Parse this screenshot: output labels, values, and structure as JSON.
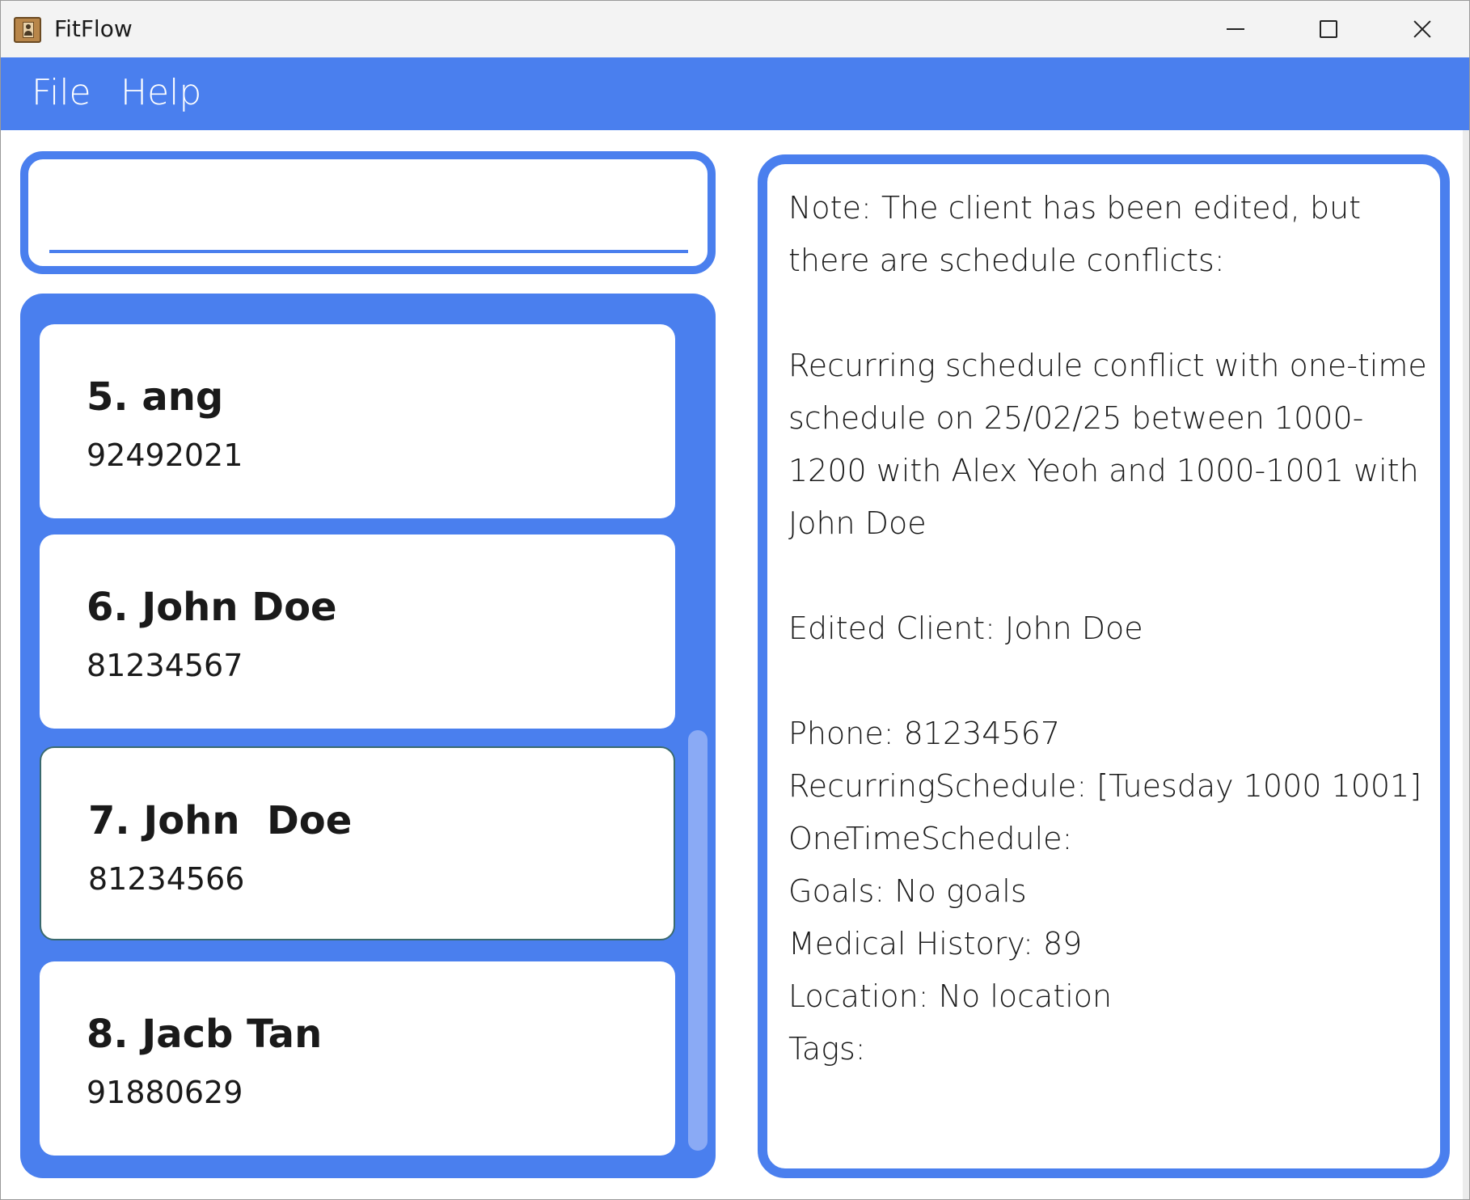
{
  "window": {
    "title": "FitFlow",
    "app_icon": "address-book-icon"
  },
  "menu": {
    "file_label": "File",
    "help_label": "Help"
  },
  "command_box": {
    "value": "",
    "placeholder": ""
  },
  "clients": [
    {
      "name": "5. ang",
      "phone": "92492021",
      "selected": false
    },
    {
      "name": "6. John Doe",
      "phone": "81234567",
      "selected": false
    },
    {
      "name": "7. John  Doe",
      "phone": "81234566",
      "selected": true
    },
    {
      "name": "8. Jacb Tan",
      "phone": "91880629",
      "selected": false
    }
  ],
  "result": {
    "text": "Note: The client has been edited, but there are schedule conflicts:\n\nRecurring schedule conflict with one-time schedule on 25/02/25 between 1000-1200 with Alex Yeoh and 1000-1001 with John Doe\n\nEdited Client: John Doe\n\nPhone: 81234567\nRecurringSchedule: [Tuesday 1000 1001]\nOneTimeSchedule: \nGoals: No goals\nMedical History: 89\nLocation: No location\nTags: "
  },
  "colors": {
    "accent": "#4a7fee",
    "titlebar_bg": "#f3f3f3",
    "card_bg": "#ffffff",
    "scrollbar": "#8aaaf5"
  }
}
